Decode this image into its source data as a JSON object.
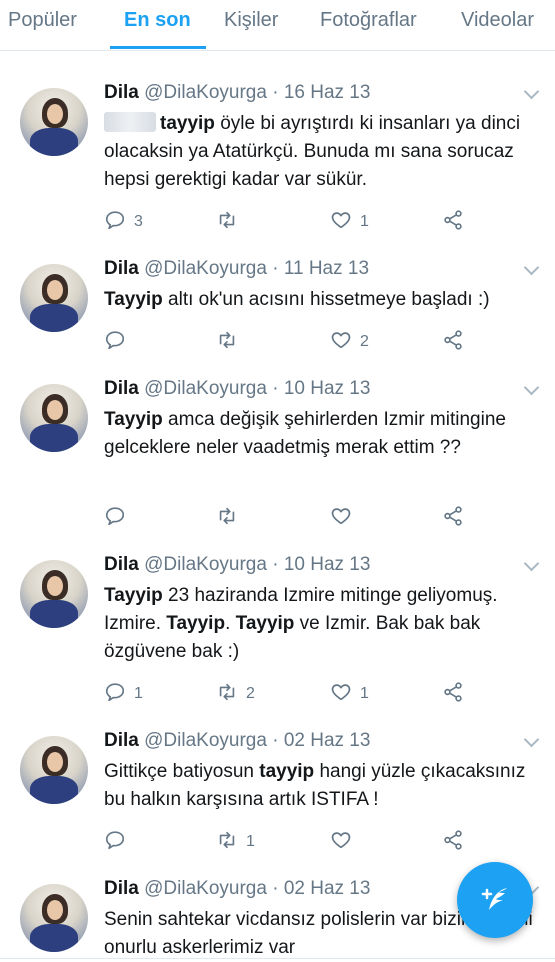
{
  "tabs": [
    {
      "label": "Popüler"
    },
    {
      "label": "En son"
    },
    {
      "label": "Kişiler"
    },
    {
      "label": "Fotoğraflar"
    },
    {
      "label": "Videolar"
    }
  ],
  "active_tab": "En son",
  "colors": {
    "accent": "#1da1f2",
    "muted": "#657786",
    "text": "#14171a",
    "border": "#e1e8ed"
  },
  "tweets": [
    {
      "name": "Dila",
      "handle": "@DilaKoyurga",
      "date": "16 Haz 13",
      "text_parts": [
        {
          "t": "tayyip",
          "bold": true
        },
        {
          "t": " öyle bi ayrıştırdı ki insanları ya dinci olacaksin ya Atatürkçü. Bunuda mı sana sorucaz hepsi gerektigi kadar var sükür.",
          "bold": false
        }
      ],
      "replies": "3",
      "retweets": "",
      "likes": "1"
    },
    {
      "name": "Dila",
      "handle": "@DilaKoyurga",
      "date": "11 Haz 13",
      "text_parts": [
        {
          "t": "Tayyip",
          "bold": true
        },
        {
          "t": " altı ok'un acısını hissetmeye başladı :)",
          "bold": false
        }
      ],
      "replies": "",
      "retweets": "",
      "likes": "2"
    },
    {
      "name": "Dila",
      "handle": "@DilaKoyurga",
      "date": "10 Haz 13",
      "text_parts": [
        {
          "t": "Tayyip",
          "bold": true
        },
        {
          "t": " amca değişik şehirlerden Izmir mitingine gelceklere neler vaadetmiş merak ettim ??",
          "bold": false
        }
      ],
      "replies": "",
      "retweets": "",
      "likes": ""
    },
    {
      "name": "Dila",
      "handle": "@DilaKoyurga",
      "date": "10 Haz 13",
      "text_parts": [
        {
          "t": "Tayyip",
          "bold": true
        },
        {
          "t": " 23 haziranda Izmire mitinge geliyomuş. Izmire. ",
          "bold": false
        },
        {
          "t": "Tayyip",
          "bold": true
        },
        {
          "t": ". ",
          "bold": false
        },
        {
          "t": "Tayyip",
          "bold": true
        },
        {
          "t": " ve Izmir. Bak bak bak özgüvene bak :)",
          "bold": false
        }
      ],
      "replies": "1",
      "retweets": "2",
      "likes": "1"
    },
    {
      "name": "Dila",
      "handle": "@DilaKoyurga",
      "date": "02 Haz 13",
      "text_parts": [
        {
          "t": "Gittikçe batiyosun ",
          "bold": false
        },
        {
          "t": "tayyip",
          "bold": true
        },
        {
          "t": " hangi yüzle çıkacaksınız bu halkın karşısına artık ISTIFA !",
          "bold": false
        }
      ],
      "replies": "",
      "retweets": "1",
      "likes": ""
    },
    {
      "name": "Dila",
      "handle": "@DilaKoyurga",
      "date": "02 Haz 13",
      "text_parts": [
        {
          "t": "Senin sahtekar vicdansız polislerin var bizim şerefli onurlu askerlerimiz var",
          "bold": false
        }
      ],
      "replies": "",
      "retweets": "",
      "likes": ""
    }
  ],
  "icons": {
    "reply": "reply-icon",
    "retweet": "retweet-icon",
    "like": "heart-icon",
    "share": "share-icon",
    "compose": "compose-tweet-icon"
  }
}
